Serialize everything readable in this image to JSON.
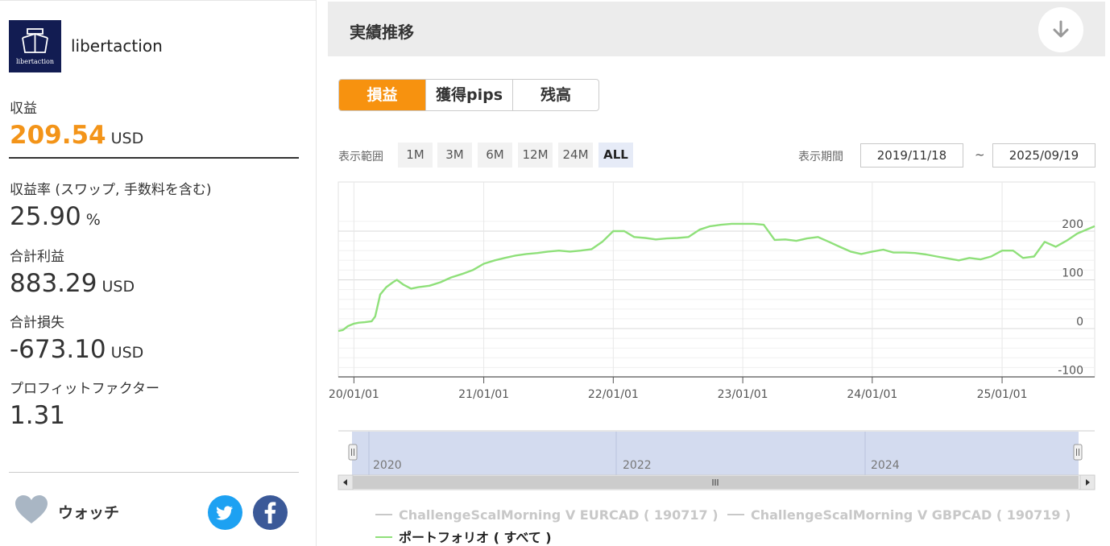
{
  "strategy": {
    "name": "libertaction",
    "logo_text": "libertaction"
  },
  "stats": {
    "profit_label": "収益",
    "profit_value": "209.54",
    "profit_unit": "USD",
    "rate_label": "収益率 (スワップ, 手数料を含む)",
    "rate_value": "25.90",
    "rate_unit": "%",
    "total_gain_label": "合計利益",
    "total_gain_value": "883.29",
    "total_gain_unit": "USD",
    "total_loss_label": "合計損失",
    "total_loss_value": "-673.10",
    "total_loss_unit": "USD",
    "pf_label": "プロフィットファクター",
    "pf_value": "1.31"
  },
  "watch": {
    "label": "ウォッチ",
    "heart_icon": "heart-icon",
    "twitter_icon": "twitter-icon",
    "facebook_icon": "facebook-icon"
  },
  "section": {
    "title": "実績推移",
    "collapse_icon": "arrow-down-icon"
  },
  "tabs": [
    "損益",
    "獲得pips",
    "残高"
  ],
  "range": {
    "label": "表示範囲",
    "options": [
      "1M",
      "3M",
      "6M",
      "12M",
      "24M",
      "ALL"
    ],
    "selected": "ALL"
  },
  "period": {
    "label": "表示期間",
    "from": "2019/11/18",
    "tilde": "~",
    "to": "2025/09/19"
  },
  "navigator": {
    "labels": [
      "2020",
      "2022",
      "2024"
    ],
    "scroll_left_icon": "arrow-left-icon",
    "scroll_right_icon": "arrow-right-icon",
    "grip_icon": "grip-icon"
  },
  "colors": {
    "accent": "#f7920f",
    "series_portfolio": "#8fe07a",
    "series_inactive": "#c8c8c8",
    "navigator_fill": "#d3dbef"
  },
  "chart_data": {
    "type": "line",
    "x_tick_labels": [
      "20/01/01",
      "21/01/01",
      "22/01/01",
      "23/01/01",
      "24/01/01",
      "25/01/01"
    ],
    "y_tick_labels": [
      "200",
      "100",
      "0",
      "-100"
    ],
    "ylim": [
      -100,
      220
    ],
    "xlim": [
      "2019-11-18",
      "2025-09-19"
    ],
    "grid": true,
    "legend_position": "bottom",
    "series": [
      {
        "name": "ChallengeScalMorning V EURCAD ( 190717 )",
        "active": false
      },
      {
        "name": "ChallengeScalMorning V GBPCAD ( 190719 )",
        "active": false
      },
      {
        "name": "ポートフォリオ ( すべて )",
        "active": true,
        "points": [
          [
            "2019-11-18",
            -5
          ],
          [
            "2019-12-01",
            -3
          ],
          [
            "2019-12-15",
            5
          ],
          [
            "2020-01-01",
            10
          ],
          [
            "2020-01-15",
            12
          ],
          [
            "2020-02-01",
            13
          ],
          [
            "2020-02-20",
            15
          ],
          [
            "2020-03-01",
            25
          ],
          [
            "2020-03-15",
            70
          ],
          [
            "2020-04-01",
            85
          ],
          [
            "2020-04-20",
            95
          ],
          [
            "2020-05-01",
            100
          ],
          [
            "2020-05-20",
            90
          ],
          [
            "2020-06-10",
            82
          ],
          [
            "2020-07-01",
            85
          ],
          [
            "2020-08-01",
            88
          ],
          [
            "2020-09-01",
            95
          ],
          [
            "2020-10-01",
            105
          ],
          [
            "2020-11-01",
            112
          ],
          [
            "2020-12-01",
            120
          ],
          [
            "2021-01-01",
            133
          ],
          [
            "2021-02-01",
            140
          ],
          [
            "2021-03-01",
            145
          ],
          [
            "2021-04-01",
            150
          ],
          [
            "2021-05-01",
            153
          ],
          [
            "2021-06-01",
            155
          ],
          [
            "2021-07-01",
            158
          ],
          [
            "2021-08-01",
            160
          ],
          [
            "2021-09-01",
            158
          ],
          [
            "2021-10-01",
            160
          ],
          [
            "2021-11-01",
            163
          ],
          [
            "2021-12-01",
            178
          ],
          [
            "2022-01-01",
            200
          ],
          [
            "2022-02-01",
            200
          ],
          [
            "2022-03-01",
            188
          ],
          [
            "2022-04-01",
            186
          ],
          [
            "2022-05-01",
            183
          ],
          [
            "2022-06-01",
            185
          ],
          [
            "2022-07-01",
            186
          ],
          [
            "2022-08-01",
            188
          ],
          [
            "2022-09-01",
            203
          ],
          [
            "2022-10-01",
            210
          ],
          [
            "2022-11-01",
            213
          ],
          [
            "2022-12-01",
            215
          ],
          [
            "2023-01-01",
            215
          ],
          [
            "2023-02-01",
            215
          ],
          [
            "2023-03-01",
            213
          ],
          [
            "2023-04-01",
            182
          ],
          [
            "2023-05-01",
            183
          ],
          [
            "2023-06-01",
            180
          ],
          [
            "2023-07-01",
            185
          ],
          [
            "2023-08-01",
            188
          ],
          [
            "2023-09-01",
            178
          ],
          [
            "2023-10-01",
            168
          ],
          [
            "2023-11-01",
            158
          ],
          [
            "2023-12-01",
            153
          ],
          [
            "2024-01-01",
            158
          ],
          [
            "2024-02-01",
            162
          ],
          [
            "2024-03-01",
            156
          ],
          [
            "2024-04-01",
            156
          ],
          [
            "2024-05-01",
            155
          ],
          [
            "2024-06-01",
            152
          ],
          [
            "2024-07-01",
            148
          ],
          [
            "2024-08-01",
            144
          ],
          [
            "2024-09-01",
            140
          ],
          [
            "2024-10-01",
            145
          ],
          [
            "2024-11-01",
            142
          ],
          [
            "2024-12-01",
            148
          ],
          [
            "2025-01-01",
            160
          ],
          [
            "2025-02-01",
            160
          ],
          [
            "2025-03-01",
            145
          ],
          [
            "2025-04-01",
            148
          ],
          [
            "2025-05-01",
            178
          ],
          [
            "2025-06-01",
            168
          ],
          [
            "2025-07-01",
            180
          ],
          [
            "2025-08-01",
            195
          ],
          [
            "2025-09-19",
            210
          ]
        ]
      }
    ]
  }
}
